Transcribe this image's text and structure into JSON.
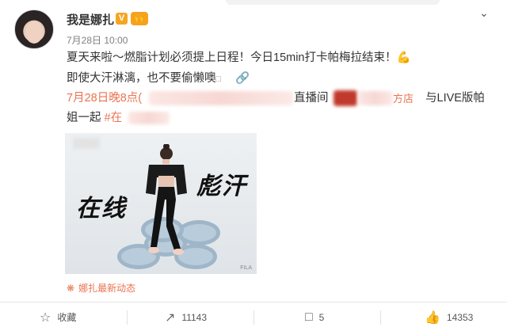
{
  "post": {
    "username": "我是娜扎",
    "v_badge": "V",
    "fan_badge": "🙌",
    "timestamp": "7月28日 10:00",
    "line1": "夏天来啦～燃脂计划必须提上日程！今日15min打卡帕梅拉结束！💪",
    "line2": "即使大汗淋漓，也不要偷懒噢",
    "line3_prefix": "7月28日晚8点(",
    "line3_live": "直播间",
    "line3_shop": "方店",
    "line3_suffix": "与LIVE版帕",
    "line4_text": "姐一起",
    "line4_tag": "#在",
    "photo_text_left": "在线",
    "photo_text_right": "彪汗",
    "photo_mark": "FILA",
    "super_topic": "娜扎最新动态"
  },
  "actions": {
    "favorite": "收藏",
    "repost": "11143",
    "comment": "5",
    "like": "14353"
  },
  "colors": {
    "link": "#eb7350",
    "badge": "#f5a623"
  }
}
